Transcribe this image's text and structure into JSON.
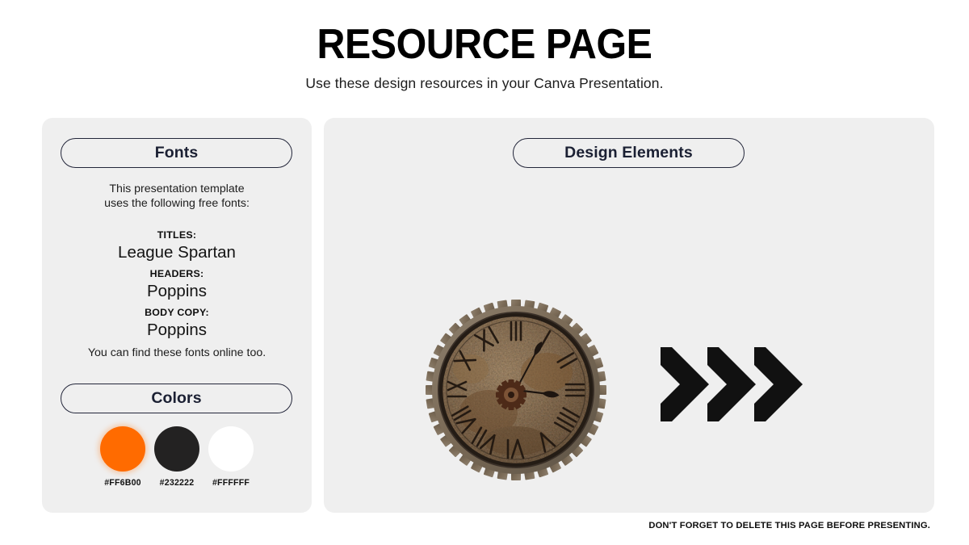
{
  "header": {
    "title": "RESOURCE PAGE",
    "subtitle": "Use these design resources in your Canva Presentation."
  },
  "fonts_panel": {
    "heading": "Fonts",
    "intro_line_1": "This presentation template",
    "intro_line_2": "uses the following free fonts:",
    "groups": [
      {
        "label": "TITLES:",
        "name": "League Spartan"
      },
      {
        "label": "HEADERS:",
        "name": "Poppins"
      },
      {
        "label": "BODY COPY:",
        "name": "Poppins"
      }
    ],
    "outro": "You can find these fonts online too."
  },
  "colors_panel": {
    "heading": "Colors",
    "swatches": [
      {
        "label": "#FF6B00",
        "hex": "#FF6B00",
        "name": "orange"
      },
      {
        "label": "#232222",
        "hex": "#232222",
        "name": "dark"
      },
      {
        "label": "#FFFFFF",
        "hex": "#FFFFFF",
        "name": "white"
      }
    ]
  },
  "design_panel": {
    "heading": "Design Elements",
    "elements": [
      {
        "name": "rusty-gear-clock-graphic",
        "type": "image"
      },
      {
        "name": "triple-chevron-arrow-graphic",
        "type": "shape",
        "color": "#111111"
      }
    ]
  },
  "footer": {
    "note": "DON'T FORGET TO DELETE THIS PAGE BEFORE PRESENTING."
  },
  "theme": {
    "page_background": "#FFFFFF",
    "panel_background": "#EFEFEF",
    "pill_border": "#23263A",
    "heading_text": "#1B2033",
    "body_text": "#1C1C1C"
  }
}
